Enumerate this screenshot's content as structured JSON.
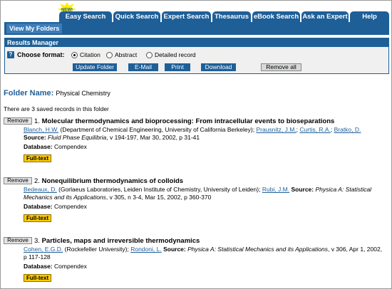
{
  "tabs": [
    {
      "label": "Easy Search"
    },
    {
      "label": "Quick Search"
    },
    {
      "label": "Expert Search"
    },
    {
      "label": "Thesaurus"
    },
    {
      "label": "eBook Search"
    },
    {
      "label": "Ask an Expert"
    },
    {
      "label": "Help"
    }
  ],
  "new_badge": "NEW!",
  "nav": {
    "view_folders": "View My Folders"
  },
  "results_manager": {
    "title": "Results Manager",
    "choose_format": "Choose format:",
    "formats": [
      {
        "label": "Citation",
        "selected": true
      },
      {
        "label": "Abstract",
        "selected": false
      },
      {
        "label": "Detailed record",
        "selected": false
      }
    ],
    "buttons": {
      "update_folder": "Update Folder",
      "email": "E-Mail",
      "print": "Print",
      "download": "Download",
      "remove_all": "Remove all"
    }
  },
  "folder": {
    "label": "Folder Name:",
    "name": "Physical Chemistry",
    "count_text": "There are 3 saved records in this folder"
  },
  "records": [
    {
      "remove": "Remove",
      "num": "1.",
      "title": "Molecular thermodynamics and bioprocessing: From intracellular events to bioseparations",
      "author1": "Blanch, H.W.",
      "aff1": " (Department of Chemical Engineering, University of California Berkeley); ",
      "author2": "Prausnitz, J.M.",
      "sep2": "; ",
      "author3": "Curtis, R.A.",
      "sep3": "; ",
      "author4": "Bratko, D.",
      "source_label": "Source:",
      "source_journal": "Fluid Phase Equilibria",
      "source_rest": ", v 194-197, Mar 30, 2002, p 31-41",
      "db_label": "Database:",
      "db": "Compendex",
      "fulltext": "Full-text"
    },
    {
      "remove": "Remove",
      "num": "2.",
      "title": "Nonequilibrium thermodynamics of colloids",
      "author1": "Bedeaux, D.",
      "aff1": " (Gorlaeus Laboratories, Leiden Institute of Chemistry, University of Leiden); ",
      "author2": "Rubi, J.M.",
      "source_label": "Source:",
      "source_journal": "Physica A: Statistical Mechanics and its Applications",
      "source_rest": ", v 305, n 3-4, Mar 15, 2002, p 360-370",
      "db_label": "Database:",
      "db": "Compendex",
      "fulltext": "Full-text"
    },
    {
      "remove": "Remove",
      "num": "3.",
      "title": "Particles, maps and irreversible thermodynamics",
      "author1": "Cohen, E.G.D.",
      "aff1": " (Rockefeller University); ",
      "author2": "Rondoni, L.",
      "source_label": "Source:",
      "source_journal": "Physica A: Statistical Mechanics and its Applications",
      "source_rest": ", v 306, Apr 1, 2002, p 117-128",
      "db_label": "Database:",
      "db": "Compendex",
      "fulltext": "Full-text"
    }
  ],
  "colors": {
    "brand_blue": "#1e5f98",
    "fulltext_yellow": "#ffcc00"
  }
}
